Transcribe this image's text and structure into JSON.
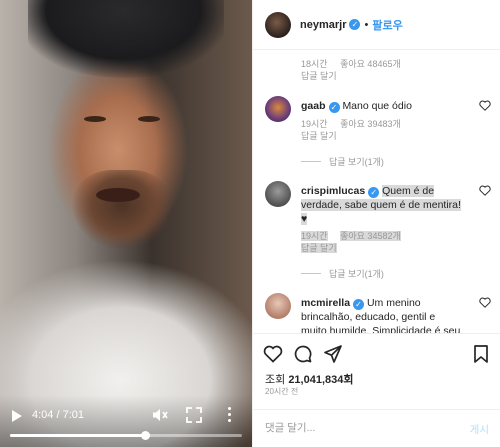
{
  "video": {
    "time": "4:04 / 7:01",
    "progress": 0.58
  },
  "header": {
    "username": "neymarjr",
    "separator": "•",
    "follow_label": "팔로우"
  },
  "comments": [
    {
      "time": "18시간",
      "likes": "좋아요 48465개",
      "reply": "답글 달기"
    },
    {
      "username": "gaab",
      "text": "Mano que ódio",
      "time": "19시간",
      "likes": "좋아요 39483개",
      "reply": "답글 달기",
      "view_replies": "답글 보기(1개)"
    },
    {
      "username": "crispimlucas",
      "text": "Quem é de verdade, sabe quem é de mentira! ♥",
      "time": "19시간",
      "likes": "좋아요 34582개",
      "reply": "답글 달기",
      "view_replies": "답글 보기(1개)"
    },
    {
      "username": "mcmirella",
      "text": "Um menino brincalhão, educado, gentil e muito humilde. Simplicidade é seu"
    }
  ],
  "stats": {
    "views_label": "조회",
    "views_count": "21,041,834회",
    "posted_ago": "20시간 전"
  },
  "add_comment": {
    "placeholder": "댓글 달기...",
    "post_label": "게시"
  },
  "colors": {
    "accent": "#3897f0",
    "verified": "#3897f0",
    "muted": "#999999"
  }
}
